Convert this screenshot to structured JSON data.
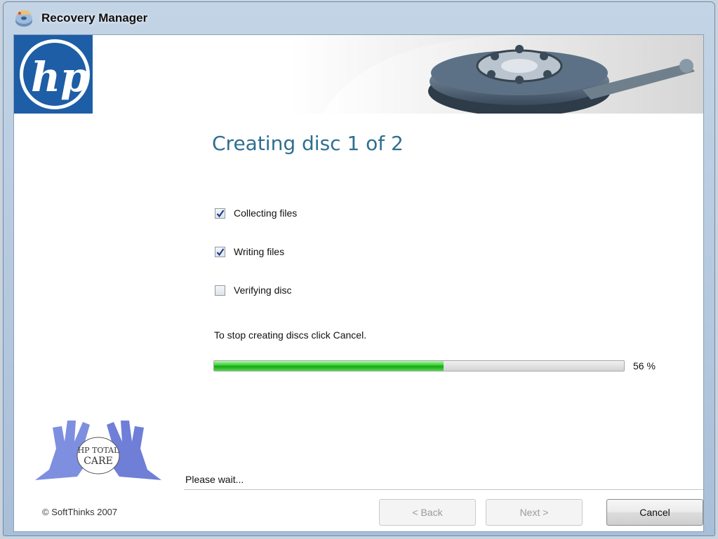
{
  "window": {
    "title": "Recovery Manager"
  },
  "heading": "Creating disc 1 of 2",
  "steps": [
    {
      "label": "Collecting files",
      "checked": true
    },
    {
      "label": "Writing files",
      "checked": true
    },
    {
      "label": "Verifying disc",
      "checked": false
    }
  ],
  "hint": "To stop creating discs click Cancel.",
  "progress": {
    "percent": 56,
    "label": "56 %"
  },
  "status": "Please wait...",
  "copyright": "© SoftThinks 2007",
  "buttons": {
    "back": "< Back",
    "next": "Next >",
    "cancel": "Cancel"
  },
  "logos": {
    "brand": "hp",
    "care": "HP TOTAL CARE"
  },
  "colors": {
    "heading": "#2f6f8f",
    "progress_fill": "#2fce2a",
    "hp_blue": "#1d5ea6"
  }
}
